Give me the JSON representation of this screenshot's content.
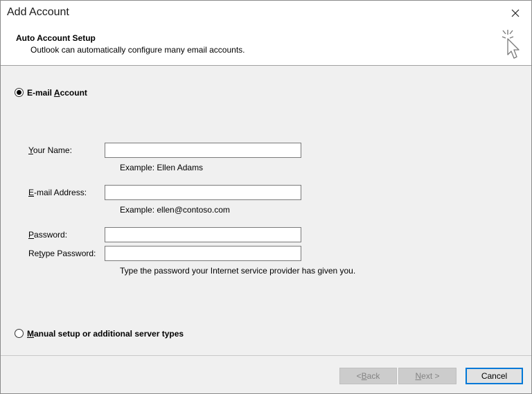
{
  "window": {
    "title": "Add Account"
  },
  "header": {
    "title": "Auto Account Setup",
    "subtitle": "Outlook can automatically configure many email accounts."
  },
  "options": {
    "email_account": {
      "label_prefix": "E-mail ",
      "label_accel": "A",
      "label_rest": "ccount",
      "selected": true
    },
    "manual_setup": {
      "label_accel": "M",
      "label_rest": "anual setup or additional server types",
      "selected": false
    }
  },
  "form": {
    "name": {
      "label_accel": "Y",
      "label_rest": "our Name:",
      "value": "",
      "hint": "Example: Ellen Adams"
    },
    "email": {
      "label_accel": "E",
      "label_rest": "-mail Address:",
      "value": "",
      "hint": "Example: ellen@contoso.com"
    },
    "password": {
      "label_accel": "P",
      "label_rest": "assword:",
      "value": ""
    },
    "retype": {
      "label_prefix": "Re",
      "label_accel": "t",
      "label_rest": "ype Password:",
      "value": "",
      "hint": "Type the password your Internet service provider has given you."
    }
  },
  "buttons": {
    "back": {
      "prefix": "< ",
      "accel": "B",
      "rest": "ack",
      "enabled": false
    },
    "next": {
      "accel": "N",
      "rest": "ext >",
      "enabled": false
    },
    "cancel": {
      "label": "Cancel",
      "enabled": true
    }
  },
  "colors": {
    "accent": "#0078d7",
    "dialog_bg": "#f0f0f0",
    "disabled_button": "#cccccc"
  }
}
